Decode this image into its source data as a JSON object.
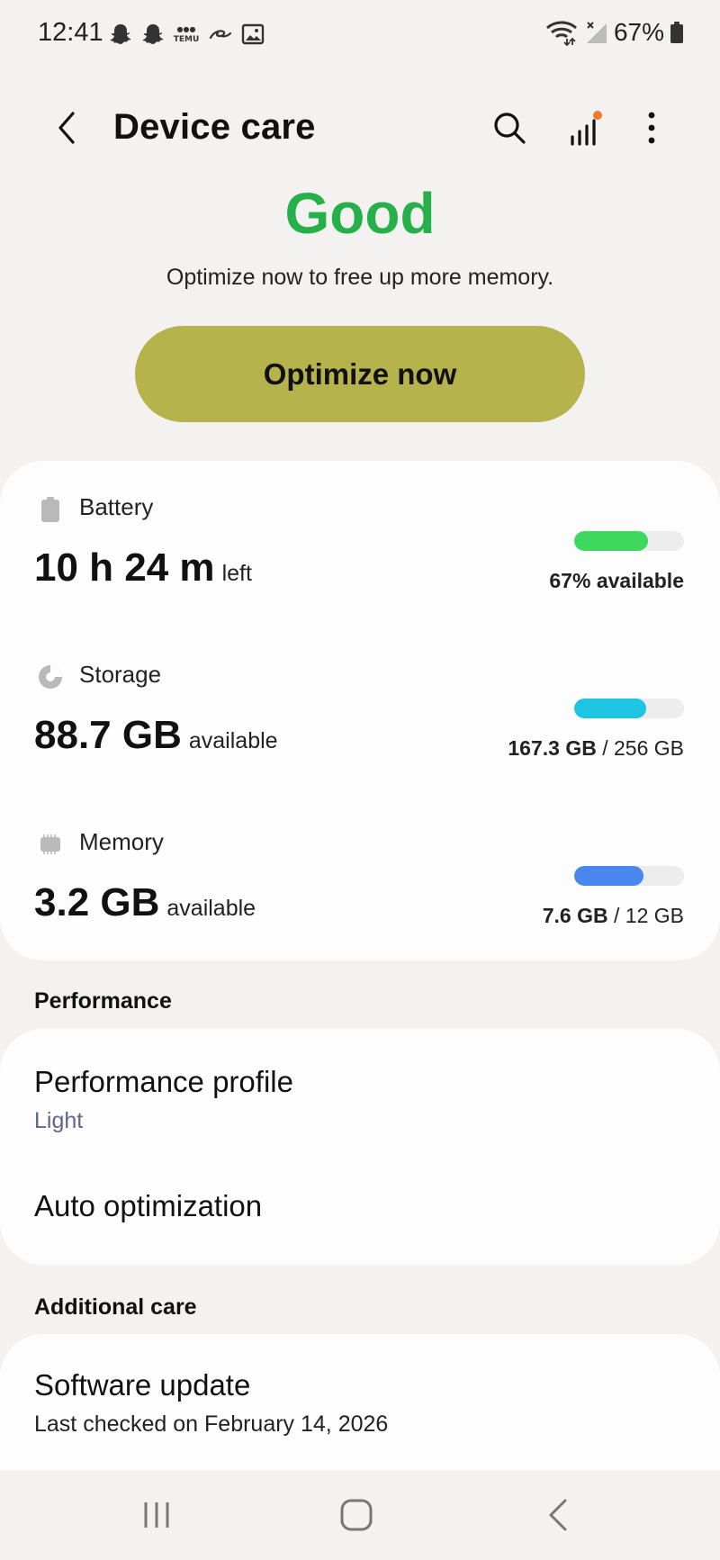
{
  "status_bar": {
    "time": "12:41",
    "notification_icons": [
      "snapchat-icon",
      "snapchat-icon",
      "temu-icon",
      "alibaba-icon",
      "gallery-icon"
    ],
    "temu_text": "TEMU",
    "battery_text": "67%"
  },
  "header": {
    "title": "Device care",
    "back_icon": "chevron-left-icon",
    "search_icon": "search-icon",
    "stats_icon": "signal-stats-icon",
    "more_icon": "more-vertical-icon"
  },
  "hero": {
    "status": "Good",
    "hint": "Optimize now to free up more memory.",
    "button_label": "Optimize now"
  },
  "resources": {
    "battery": {
      "label": "Battery",
      "value": "10 h 24 m",
      "suffix": "left",
      "detail_bold": "67% available",
      "detail_rest": "",
      "level": 0.67,
      "color": "#3ed85e"
    },
    "storage": {
      "label": "Storage",
      "value": "88.7 GB",
      "suffix": "available",
      "detail_bold": "167.3 GB",
      "detail_rest": " / 256 GB",
      "level": 0.653,
      "color": "#1ec5e2"
    },
    "memory": {
      "label": "Memory",
      "value": "3.2 GB",
      "suffix": "available",
      "detail_bold": "7.6 GB",
      "detail_rest": " / 12 GB",
      "level": 0.633,
      "color": "#4a86f0"
    }
  },
  "performance": {
    "section_label": "Performance",
    "items": [
      {
        "title": "Performance profile",
        "subtitle": "Light"
      },
      {
        "title": "Auto optimization"
      }
    ]
  },
  "additional_care": {
    "section_label": "Additional care",
    "items": [
      {
        "title": "Software update",
        "subtitle": "Last checked on February 14, 2026"
      }
    ]
  },
  "colors": {
    "good": "#27b04a",
    "accent_button": "#b6b24c",
    "background": "#f3f2f0",
    "subtitle": "#5d6690",
    "notification_dot": "#f0782a"
  }
}
